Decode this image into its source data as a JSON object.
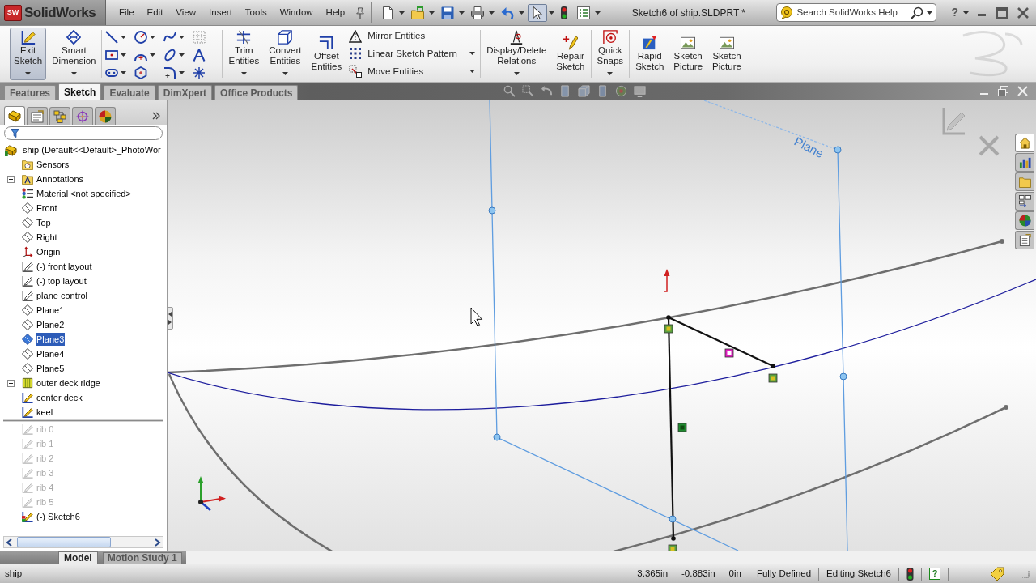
{
  "app": {
    "logo_badge": "SW",
    "logo": "SolidWorks",
    "menus": [
      "File",
      "Edit",
      "View",
      "Insert",
      "Tools",
      "Window",
      "Help"
    ],
    "quick_access": [
      {
        "kind": "new",
        "pressed": false,
        "dropdown": true
      },
      {
        "kind": "open",
        "pressed": false,
        "dropdown": true
      },
      {
        "kind": "save",
        "pressed": false,
        "dropdown": true
      },
      {
        "kind": "print",
        "pressed": false,
        "dropdown": true
      },
      {
        "kind": "undo",
        "pressed": false,
        "dropdown": true
      },
      {
        "kind": "select",
        "pressed": true,
        "dropdown": true
      },
      {
        "kind": "rebuild",
        "pressed": false,
        "dropdown": false
      },
      {
        "kind": "options",
        "pressed": false,
        "dropdown": true
      }
    ],
    "title": "Sketch6 of ship.SLDPRT *",
    "search": {
      "placeholder": "Search SolidWorks Help"
    },
    "help": "?"
  },
  "ribbon": {
    "sections": [
      {
        "buttons": [
          {
            "kind": "exit_sketch",
            "label": "Exit Sketch",
            "pressed": true,
            "dropdown": true
          },
          {
            "kind": "dimension",
            "label": "Smart Dimension",
            "pressed": false,
            "dropdown": true
          }
        ]
      },
      {
        "grid": [
          {
            "kind": "line",
            "dropdown": true
          },
          {
            "kind": "circle",
            "dropdown": true
          },
          {
            "kind": "spline",
            "dropdown": true
          },
          {
            "kind": "construction",
            "dropdown": false
          },
          {
            "kind": "rectangle",
            "dropdown": true
          },
          {
            "kind": "arc",
            "dropdown": true
          },
          {
            "kind": "ellipse",
            "dropdown": true
          },
          {
            "kind": "text",
            "dropdown": false
          },
          {
            "kind": "slot",
            "dropdown": true
          },
          {
            "kind": "polygon",
            "dropdown": false
          },
          {
            "kind": "fillet",
            "dropdown": true
          },
          {
            "kind": "point",
            "dropdown": false
          }
        ]
      },
      {
        "buttons": [
          {
            "kind": "trim",
            "label": "Trim Entities",
            "pressed": false,
            "dropdown": true
          },
          {
            "kind": "convert",
            "label": "Convert Entities",
            "pressed": false,
            "dropdown": true
          },
          {
            "kind": "offset",
            "label": "Offset Entities",
            "pressed": false,
            "dropdown": false
          }
        ],
        "rows": [
          {
            "kind": "mirror",
            "label": "Mirror Entities",
            "dropdown": false
          },
          {
            "kind": "linear_pattern",
            "label": "Linear Sketch Pattern",
            "dropdown": true
          },
          {
            "kind": "move",
            "label": "Move Entities",
            "dropdown": true
          }
        ]
      },
      {
        "buttons": [
          {
            "kind": "relations",
            "label": "Display/Delete Relations",
            "pressed": false,
            "dropdown": true
          },
          {
            "kind": "repair",
            "label": "Repair Sketch",
            "pressed": false,
            "dropdown": false
          }
        ]
      },
      {
        "buttons": [
          {
            "kind": "quick_snaps",
            "label": "Quick Snaps",
            "pressed": false,
            "dropdown": true
          }
        ]
      },
      {
        "buttons": [
          {
            "kind": "rapid_sketch",
            "label": "Rapid Sketch",
            "pressed": false,
            "dropdown": false
          },
          {
            "kind": "sketch_picture",
            "label": "Sketch Picture",
            "pressed": false,
            "dropdown": false
          },
          {
            "kind": "sketch_picture",
            "label": "Sketch Picture",
            "pressed": false,
            "dropdown": false
          }
        ]
      }
    ]
  },
  "tabs": [
    {
      "label": "Features",
      "selected": false
    },
    {
      "label": "Sketch",
      "selected": true
    },
    {
      "label": "Evaluate",
      "selected": false
    },
    {
      "label": "DimXpert",
      "selected": false
    },
    {
      "label": "Office Products",
      "selected": false
    }
  ],
  "feature_manager": {
    "tabs": [
      {
        "kind": "feature_tree",
        "selected": true
      },
      {
        "kind": "property",
        "selected": false
      },
      {
        "kind": "configuration",
        "selected": false
      },
      {
        "kind": "dimxpert",
        "selected": false
      },
      {
        "kind": "display",
        "selected": false
      }
    ],
    "tree": {
      "root": "ship (Default<<Default>_PhotoWor",
      "items": [
        {
          "label": "Sensors",
          "kind": "sensors",
          "expandable": false,
          "selected": false,
          "rolled_back": false
        },
        {
          "label": "Annotations",
          "kind": "annotations",
          "expandable": true,
          "selected": false,
          "rolled_back": false
        },
        {
          "label": "Material <not specified>",
          "kind": "material",
          "expandable": false,
          "selected": false,
          "rolled_back": false
        },
        {
          "label": "Front",
          "kind": "plane",
          "expandable": false,
          "selected": false,
          "rolled_back": false
        },
        {
          "label": "Top",
          "kind": "plane",
          "expandable": false,
          "selected": false,
          "rolled_back": false
        },
        {
          "label": "Right",
          "kind": "plane",
          "expandable": false,
          "selected": false,
          "rolled_back": false
        },
        {
          "label": "Origin",
          "kind": "origin",
          "expandable": false,
          "selected": false,
          "rolled_back": false
        },
        {
          "label": "(-) front layout",
          "kind": "sketch",
          "expandable": false,
          "selected": false,
          "rolled_back": false
        },
        {
          "label": "(-) top layout",
          "kind": "sketch",
          "expandable": false,
          "selected": false,
          "rolled_back": false
        },
        {
          "label": "plane control",
          "kind": "sketch",
          "expandable": false,
          "selected": false,
          "rolled_back": false
        },
        {
          "label": "Plane1",
          "kind": "plane",
          "expandable": false,
          "selected": false,
          "rolled_back": false
        },
        {
          "label": "Plane2",
          "kind": "plane",
          "expandable": false,
          "selected": false,
          "rolled_back": false
        },
        {
          "label": "Plane3",
          "kind": "plane",
          "expandable": false,
          "selected": true,
          "rolled_back": false
        },
        {
          "label": "Plane4",
          "kind": "plane",
          "expandable": false,
          "selected": false,
          "rolled_back": false
        },
        {
          "label": "Plane5",
          "kind": "plane",
          "expandable": false,
          "selected": false,
          "rolled_back": false
        },
        {
          "label": "outer deck ridge",
          "kind": "surface",
          "expandable": true,
          "selected": false,
          "rolled_back": false
        },
        {
          "label": "center deck",
          "kind": "sketch3d",
          "expandable": false,
          "selected": false,
          "rolled_back": false
        },
        {
          "label": "keel",
          "kind": "sketch3d",
          "expandable": false,
          "selected": false,
          "rolled_back": false
        },
        {
          "label": "rib 0",
          "kind": "sketch",
          "expandable": false,
          "selected": false,
          "rolled_back": true
        },
        {
          "label": "rib 1",
          "kind": "sketch",
          "expandable": false,
          "selected": false,
          "rolled_back": true
        },
        {
          "label": "rib 2",
          "kind": "sketch",
          "expandable": false,
          "selected": false,
          "rolled_back": true
        },
        {
          "label": "rib 3",
          "kind": "sketch",
          "expandable": false,
          "selected": false,
          "rolled_back": true
        },
        {
          "label": "rib 4",
          "kind": "sketch",
          "expandable": false,
          "selected": false,
          "rolled_back": true
        },
        {
          "label": "rib 5",
          "kind": "sketch",
          "expandable": false,
          "selected": false,
          "rolled_back": true
        },
        {
          "label": "(-) Sketch6",
          "kind": "active_sketch",
          "expandable": false,
          "selected": false,
          "rolled_back": false
        }
      ]
    },
    "bottom_tabs": [
      {
        "label": "Model",
        "selected": true
      },
      {
        "label": "Motion Study 1",
        "selected": false
      }
    ]
  },
  "viewport": {
    "plane_label": "Plane"
  },
  "task_pane": [
    {
      "kind": "home",
      "selected": true
    },
    {
      "kind": "library",
      "selected": false
    },
    {
      "kind": "explorer",
      "selected": false
    },
    {
      "kind": "view_palette",
      "selected": false
    },
    {
      "kind": "appearances",
      "selected": false
    },
    {
      "kind": "properties",
      "selected": false
    }
  ],
  "status_bar": {
    "text": "ship",
    "fields": [
      "3.365in",
      "-0.883in",
      "0in",
      "Fully Defined",
      "Editing Sketch6"
    ],
    "help": "?"
  }
}
